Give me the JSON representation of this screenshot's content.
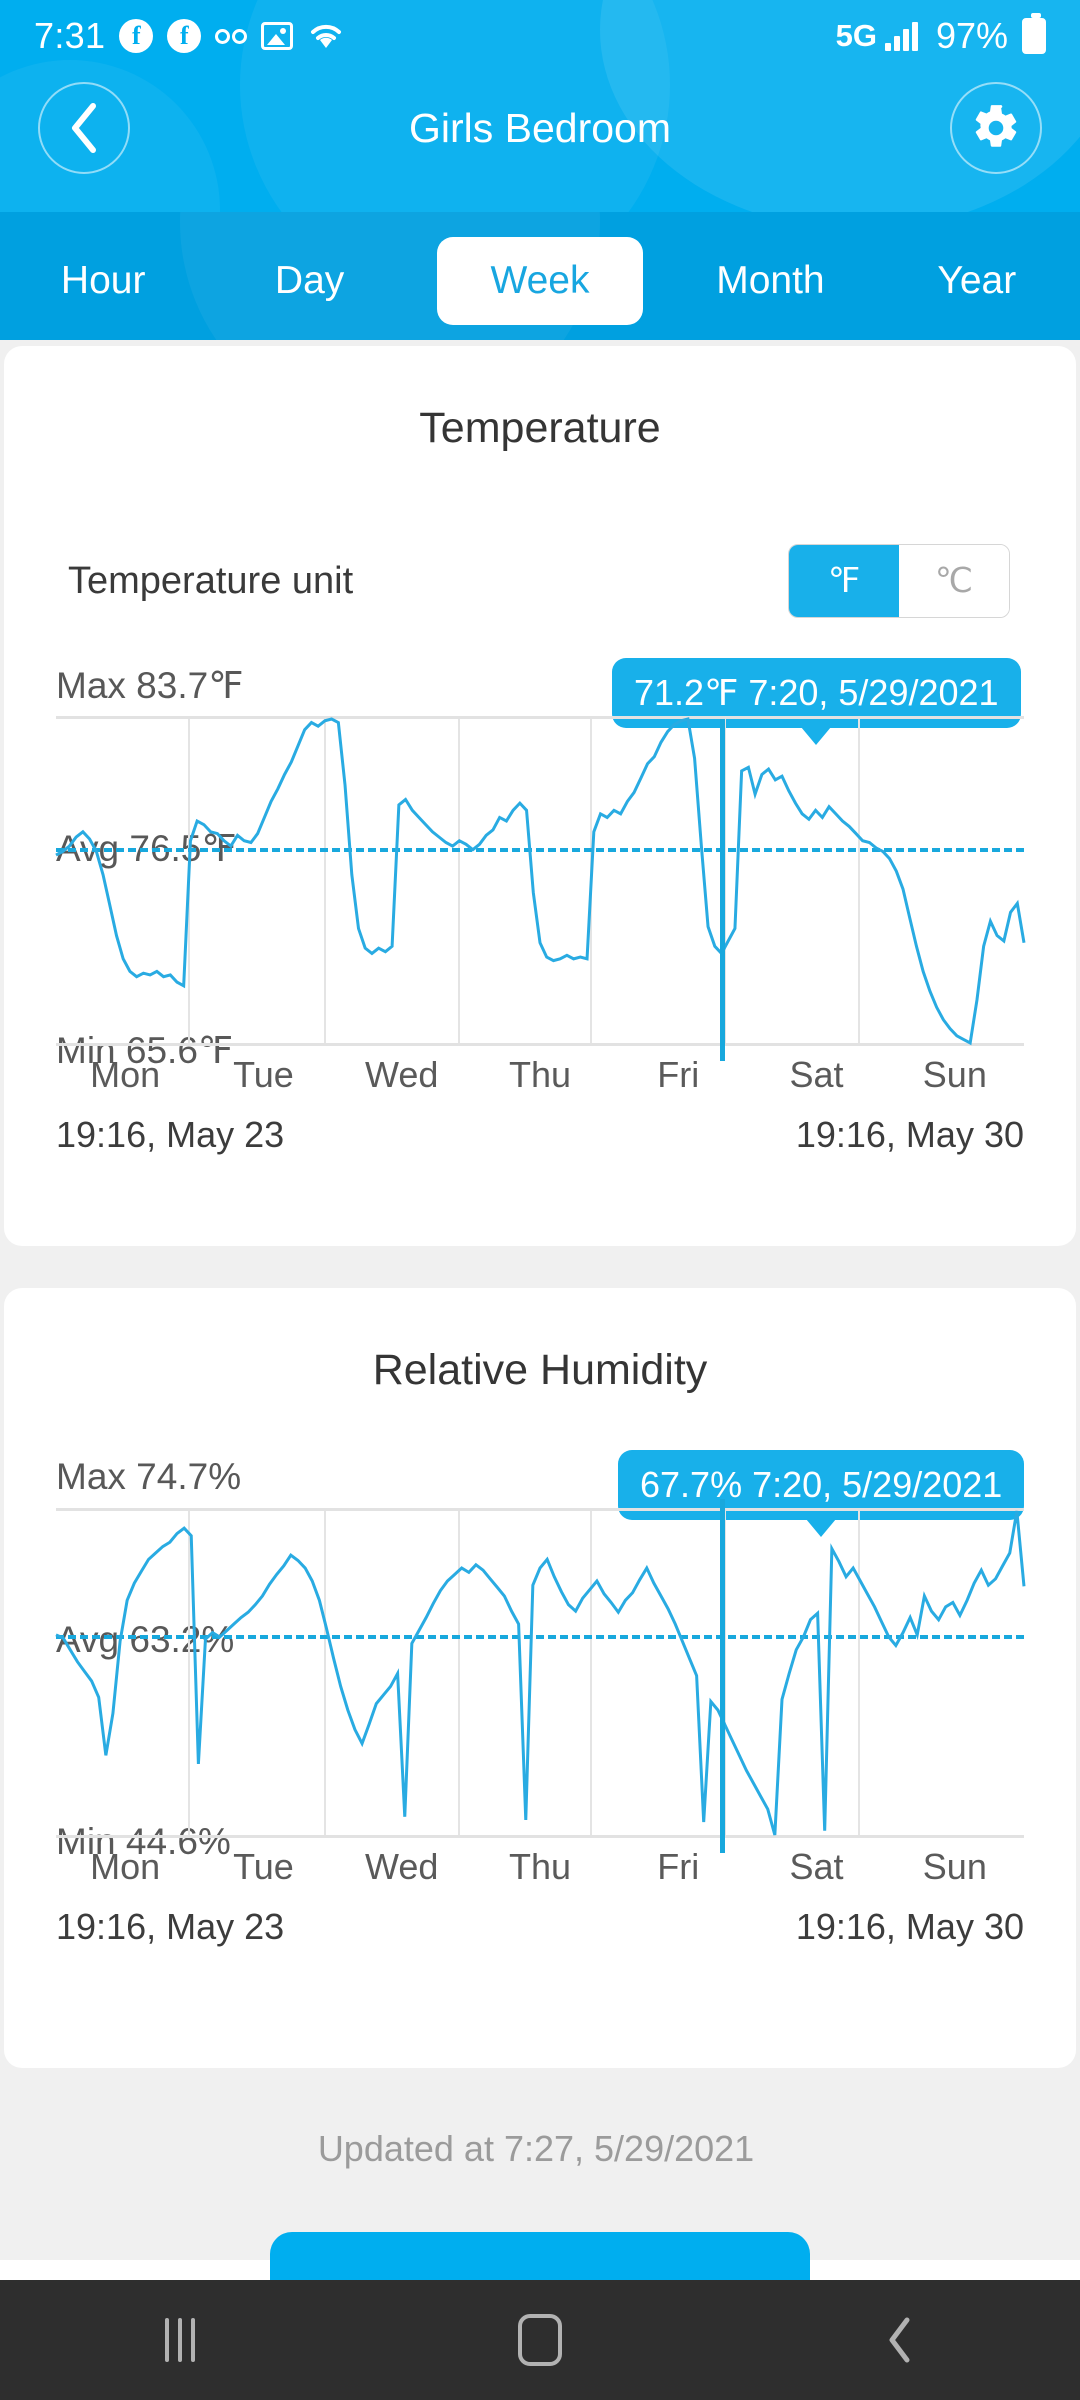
{
  "status_bar": {
    "time": "7:31",
    "network": "5G",
    "battery": "97%",
    "icons": [
      "facebook-icon",
      "facebook-icon",
      "voicemail-icon",
      "photo-icon",
      "wifi-icon"
    ]
  },
  "header": {
    "title": "Girls Bedroom",
    "back_icon": "chevron-left-icon",
    "settings_icon": "gear-icon",
    "accent": "#00aeef"
  },
  "period_tabs": {
    "items": [
      "Hour",
      "Day",
      "Week",
      "Month",
      "Year"
    ],
    "selected": "Week"
  },
  "temperature": {
    "title": "Temperature",
    "unit_label": "Temperature unit",
    "unit_options": [
      "℉",
      "℃"
    ],
    "unit_selected": "℉",
    "max_label": "Max 83.7℉",
    "avg_label": "Avg 76.5℉",
    "min_label": "Min 65.6℉",
    "tooltip": "71.2℉ 7:20,  5/29/2021",
    "range_start": "19:16,  May 23",
    "range_end": "19:16,  May 30"
  },
  "humidity": {
    "title": "Relative Humidity",
    "max_label": "Max 74.7%",
    "avg_label": "Avg 63.2%",
    "min_label": "Min 44.6%",
    "tooltip": "67.7% 7:20,  5/29/2021",
    "range_start": "19:16,  May 23",
    "range_end": "19:16,  May 30"
  },
  "footer": {
    "updated": "Updated at 7:27,  5/29/2021"
  },
  "android_nav": {
    "recents_icon": "recents-icon",
    "home_icon": "home-icon",
    "back_icon": "back-icon"
  },
  "chart_data": [
    {
      "type": "line",
      "title": "Temperature",
      "xlabel": "",
      "ylabel": "℉",
      "ylim": [
        65.6,
        83.7
      ],
      "max": 83.7,
      "avg": 76.5,
      "min": 65.6,
      "unit": "℉",
      "grid": true,
      "legend": "none",
      "categories": [
        "Mon",
        "Tue",
        "Wed",
        "Thu",
        "Fri",
        "Sat",
        "Sun"
      ],
      "x_range": [
        "19:16,  May 23",
        "19:16,  May 30"
      ],
      "avg_line": 76.5,
      "cursor": {
        "x_label": "7:20,  5/29/2021",
        "value": 71.2
      },
      "series": [
        {
          "name": "Temperature",
          "color": "#29abe2",
          "values": [
            76.1,
            76.3,
            76.6,
            77.1,
            77.4,
            77.0,
            76.3,
            75.0,
            73.3,
            71.6,
            70.3,
            69.6,
            69.3,
            69.5,
            69.4,
            69.6,
            69.3,
            69.4,
            69.0,
            68.8,
            76.9,
            78.0,
            77.8,
            77.4,
            77.3,
            76.9,
            76.6,
            77.2,
            76.9,
            76.8,
            77.3,
            78.2,
            79.1,
            79.8,
            80.6,
            81.3,
            82.2,
            83.1,
            83.5,
            83.3,
            83.6,
            83.7,
            83.5,
            80.0,
            75.0,
            72.0,
            70.9,
            70.6,
            70.9,
            70.7,
            71.0,
            78.9,
            79.2,
            78.6,
            78.2,
            77.8,
            77.4,
            77.1,
            76.8,
            76.6,
            76.9,
            76.7,
            76.4,
            76.7,
            77.2,
            77.5,
            78.2,
            78.0,
            78.6,
            79.0,
            78.6,
            74.0,
            71.2,
            70.4,
            70.2,
            70.3,
            70.5,
            70.3,
            70.4,
            70.3,
            77.4,
            78.4,
            78.2,
            78.6,
            78.4,
            79.1,
            79.6,
            80.4,
            81.2,
            81.6,
            82.4,
            83.0,
            83.4,
            83.6,
            83.7,
            81.5,
            76.6,
            72.1,
            71.0,
            70.6,
            71.3,
            72.0,
            80.8,
            81.0,
            79.5,
            80.6,
            80.9,
            80.3,
            80.5,
            79.7,
            79.0,
            78.4,
            78.1,
            78.6,
            78.2,
            78.8,
            78.4,
            78.0,
            77.7,
            77.3,
            76.9,
            76.8,
            76.5,
            76.3,
            75.9,
            75.2,
            74.2,
            72.6,
            71.0,
            69.6,
            68.5,
            67.6,
            66.9,
            66.4,
            66.0,
            65.8,
            65.6,
            68.0,
            71.0,
            72.4,
            71.6,
            71.3,
            72.9,
            73.4,
            71.2
          ]
        }
      ]
    },
    {
      "type": "line",
      "title": "Relative Humidity",
      "xlabel": "",
      "ylabel": "%",
      "ylim": [
        44.6,
        74.7
      ],
      "max": 74.7,
      "avg": 63.2,
      "min": 44.6,
      "unit": "%",
      "grid": true,
      "legend": "none",
      "categories": [
        "Mon",
        "Tue",
        "Wed",
        "Thu",
        "Fri",
        "Sat",
        "Sun"
      ],
      "x_range": [
        "19:16,  May 23",
        "19:16,  May 30"
      ],
      "avg_line": 63.2,
      "cursor": {
        "x_label": "7:20,  5/29/2021",
        "value": 67.7
      },
      "series": [
        {
          "name": "Relative Humidity",
          "color": "#29abe2",
          "values": [
            63.2,
            62.9,
            61.8,
            60.7,
            59.8,
            58.9,
            57.4,
            52.0,
            55.9,
            62.6,
            66.4,
            68.0,
            69.1,
            70.2,
            70.8,
            71.4,
            71.8,
            72.6,
            73.1,
            72.4,
            51.2,
            62.8,
            63.4,
            63.0,
            63.6,
            64.2,
            64.8,
            65.3,
            66.0,
            66.8,
            67.9,
            68.8,
            69.6,
            70.6,
            70.1,
            69.4,
            68.2,
            66.4,
            63.8,
            61.0,
            58.4,
            56.2,
            54.4,
            53.1,
            54.9,
            56.8,
            57.6,
            58.4,
            59.6,
            46.3,
            62.4,
            63.6,
            64.8,
            66.1,
            67.3,
            68.2,
            68.8,
            69.4,
            69.0,
            69.7,
            69.2,
            68.4,
            67.6,
            66.8,
            65.4,
            64.2,
            46.0,
            67.8,
            69.4,
            70.2,
            68.6,
            67.2,
            66.0,
            65.4,
            66.6,
            67.4,
            68.2,
            67.0,
            66.2,
            65.3,
            66.4,
            67.1,
            68.3,
            69.4,
            68.0,
            66.8,
            65.6,
            64.2,
            62.6,
            61.0,
            59.4,
            45.8,
            57.0,
            56.2,
            54.8,
            53.4,
            52.0,
            50.6,
            49.4,
            48.2,
            47.0,
            44.6,
            57.2,
            59.6,
            61.8,
            63.0,
            64.6,
            65.2,
            45.0,
            71.2,
            70.0,
            68.6,
            69.4,
            68.2,
            67.0,
            65.8,
            64.4,
            63.0,
            62.2,
            63.4,
            64.8,
            63.2,
            66.8,
            65.4,
            64.6,
            65.8,
            66.2,
            65.0,
            66.4,
            68.0,
            69.2,
            67.8,
            68.4,
            69.6,
            70.8,
            74.7,
            67.7
          ]
        }
      ]
    }
  ]
}
